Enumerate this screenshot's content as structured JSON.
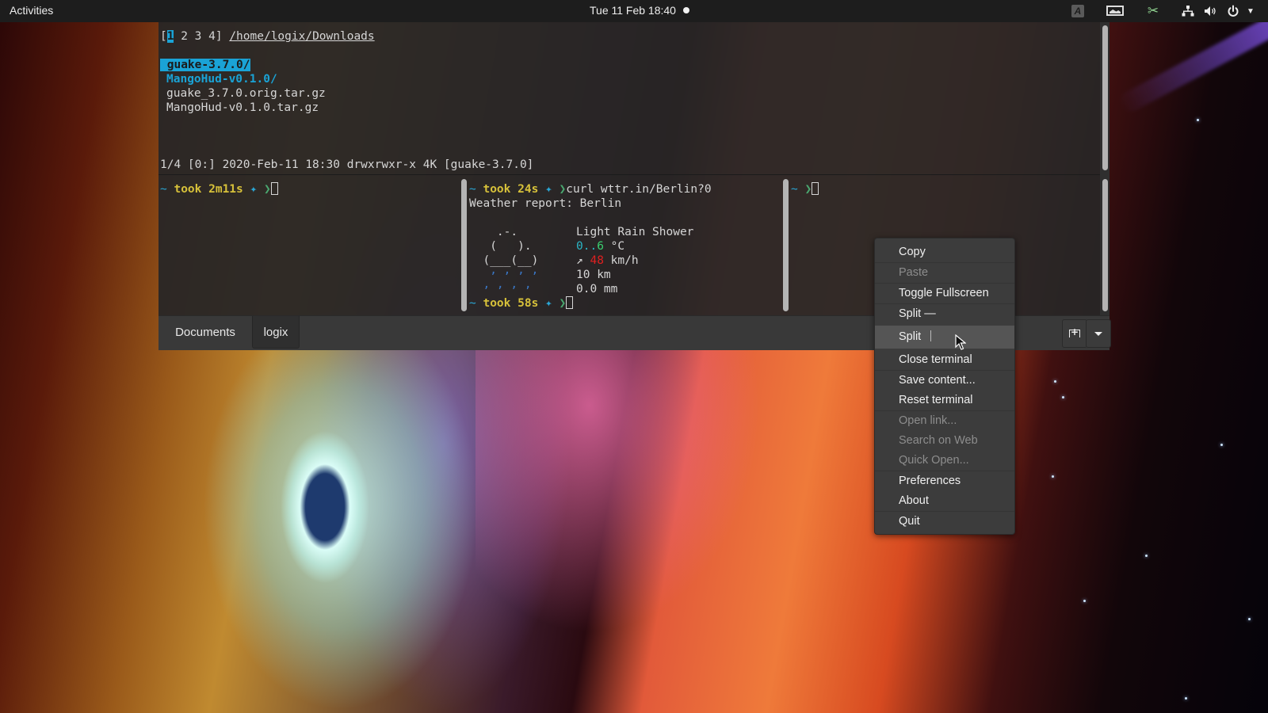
{
  "topbar": {
    "activities": "Activities",
    "clock": "Tue 11 Feb  18:40",
    "tray_icons": [
      "keyboard-layout-icon",
      "screenshot-icon",
      "clipboard-indicator-icon",
      "network-icon",
      "volume-icon",
      "power-icon",
      "system-menu-caret-icon"
    ]
  },
  "terminal": {
    "top_pane": {
      "workspace_prefix": "[",
      "workspace_active": "1",
      "workspace_rest": " 2 3 4]",
      "path": "/home/logix/Downloads",
      "entries": [
        {
          "name": "guake-3.7.0/",
          "type": "dir",
          "selected": true
        },
        {
          "name": "MangoHud-v0.1.0/",
          "type": "dir",
          "selected": false
        },
        {
          "name": "guake_3.7.0.orig.tar.gz",
          "type": "file",
          "selected": false
        },
        {
          "name": "MangoHud-v0.1.0.tar.gz",
          "type": "file",
          "selected": false
        }
      ],
      "status_line": "1/4 [0:] 2020-Feb-11 18:30 drwxrwxr-x 4K [guake-3.7.0]"
    },
    "left_pane": {
      "prompt_tilde": "~",
      "prompt_took": "took 2m11s",
      "prompt_star": "✦",
      "prompt_arrow": "❯"
    },
    "middle_pane": {
      "prompt1_tilde": "~",
      "prompt1_took": "took 24s",
      "prompt_star": "✦",
      "prompt_arrow": "❯",
      "command": "curl wttr.in/Berlin?0",
      "report_title": "Weather report: Berlin",
      "art": [
        "    .-.    ",
        "   (   ).  ",
        "  (___(__) ",
        "   ‚ ‚ ‚ ‚ ",
        "  ‚ ‚ ‚ ‚  "
      ],
      "condition": "Light Rain Shower",
      "temp_low": "0",
      "temp_sep": "..",
      "temp_high": "6",
      "temp_unit": " °C",
      "wind_arrow": "↗",
      "wind_speed": "48",
      "wind_unit": " km/h",
      "visibility": "10 km",
      "precipitation": "0.0 mm",
      "prompt2_tilde": "~",
      "prompt2_took": "took 58s"
    },
    "right_pane": {
      "prompt_tilde": "~",
      "prompt_arrow": "❯"
    },
    "tabs": [
      {
        "label": "Documents",
        "active": false
      },
      {
        "label": "logix",
        "active": true
      }
    ]
  },
  "context_menu": {
    "items": [
      {
        "label": "Copy",
        "enabled": true
      },
      {
        "label": "Paste",
        "enabled": false
      },
      {
        "label": "Toggle Fullscreen",
        "enabled": true
      },
      {
        "label": "Split —",
        "enabled": true
      },
      {
        "label": "Split",
        "enabled": true,
        "highlighted": true
      },
      {
        "label": "Close terminal",
        "enabled": true
      },
      {
        "label": "Save content...",
        "enabled": true
      },
      {
        "label": "Reset terminal",
        "enabled": true
      },
      {
        "label": "Open link...",
        "enabled": false
      },
      {
        "label": "Search on Web",
        "enabled": false
      },
      {
        "label": "Quick Open...",
        "enabled": false
      },
      {
        "label": "Preferences",
        "enabled": true
      },
      {
        "label": "About",
        "enabled": true
      },
      {
        "label": "Quit",
        "enabled": true
      }
    ]
  },
  "colors": {
    "accent_blue": "#1aa3d6",
    "prompt_yellow": "#d7c13a",
    "prompt_green": "#4aa870",
    "wind_red": "#e02020"
  }
}
